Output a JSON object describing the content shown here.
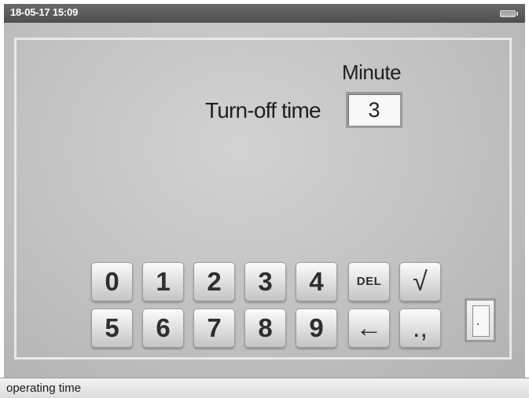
{
  "header": {
    "datetime": "18-05-17 15:09",
    "battery_icon": "battery-icon"
  },
  "main": {
    "unit_label": "Minute",
    "field_label": "Turn-off time",
    "field_value": "3"
  },
  "keypad": {
    "row1": [
      "0",
      "1",
      "2",
      "3",
      "4",
      "DEL",
      "√"
    ],
    "row2": [
      "5",
      "6",
      "7",
      "8",
      "9",
      "←",
      ".,"
    ]
  },
  "door_icon": "door-icon",
  "status": {
    "text": "operating time"
  }
}
